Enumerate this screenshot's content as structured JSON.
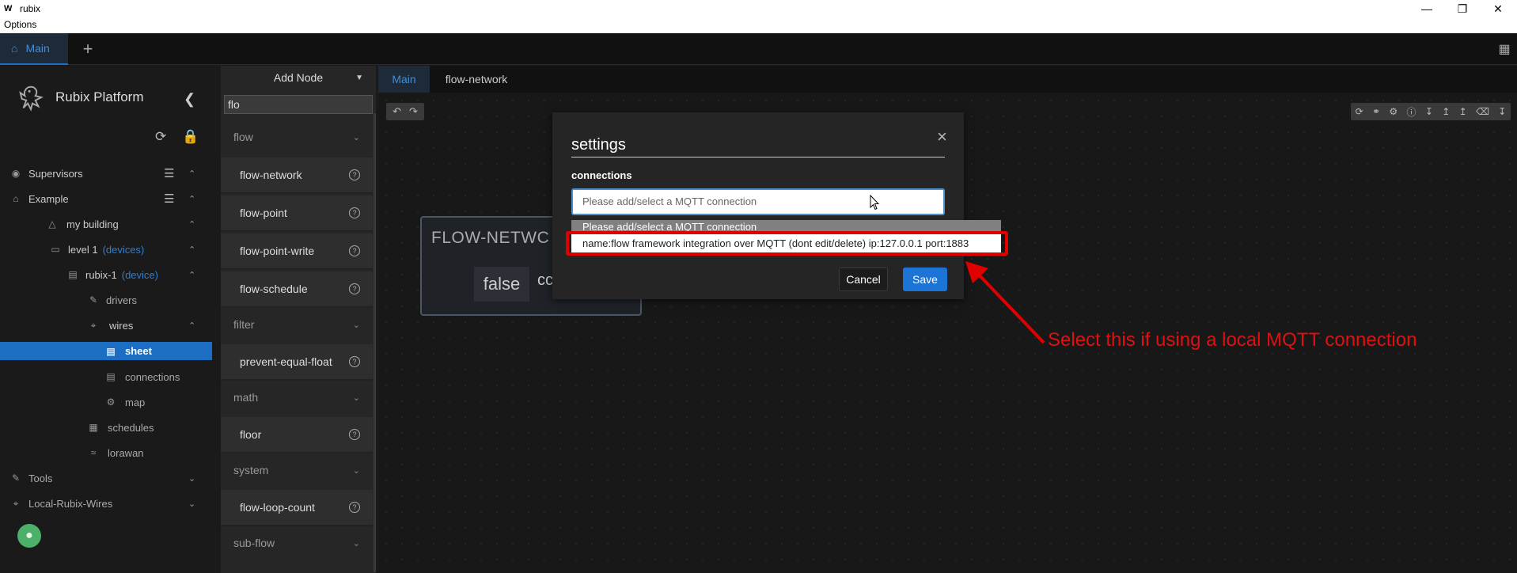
{
  "window": {
    "logo_text": "W",
    "title": "rubix",
    "menu": "Options",
    "minimize_icon": "minimize-icon",
    "restore_icon": "restore-icon",
    "close_icon": "close-icon"
  },
  "app_tabs": {
    "main_label": "Main",
    "add_label": "+"
  },
  "sidebar": {
    "brand": "Rubix Platform",
    "items": [
      {
        "label": "Supervisors",
        "icon": "eye-icon"
      },
      {
        "label": "Example",
        "icon": "home-icon"
      },
      {
        "label": "my building",
        "icon": "warning-icon"
      },
      {
        "label": "level 1",
        "tag": "(devices)",
        "icon": "laptop-icon"
      },
      {
        "label": "rubix-1",
        "tag": "(device)",
        "icon": "server-icon"
      },
      {
        "label": "drivers",
        "icon": "wrench-icon"
      },
      {
        "label": "wires",
        "icon": "wires-icon"
      },
      {
        "label": "sheet",
        "icon": "sheet-icon"
      },
      {
        "label": "connections",
        "icon": "connections-icon"
      },
      {
        "label": "map",
        "icon": "map-icon"
      },
      {
        "label": "schedules",
        "icon": "calendar-icon"
      },
      {
        "label": "lorawan",
        "icon": "wifi-icon"
      },
      {
        "label": "Tools",
        "icon": "wrench-icon"
      },
      {
        "label": "Local-Rubix-Wires",
        "icon": "wires-icon"
      }
    ]
  },
  "node_panel": {
    "title": "Add Node",
    "search_value": "flo",
    "categories": [
      {
        "label": "flow"
      },
      {
        "label": "filter"
      },
      {
        "label": "math"
      },
      {
        "label": "system"
      },
      {
        "label": "sub-flow"
      }
    ],
    "nodes": [
      {
        "label": "flow-network"
      },
      {
        "label": "flow-point"
      },
      {
        "label": "flow-point-write"
      },
      {
        "label": "flow-schedule"
      },
      {
        "label": "prevent-equal-float"
      },
      {
        "label": "floor"
      },
      {
        "label": "flow-loop-count"
      }
    ],
    "help_glyph": "?"
  },
  "editor": {
    "tabs": [
      "Main",
      "flow-network"
    ]
  },
  "canvas_node": {
    "header": "FLOW-NETWC",
    "value": "false",
    "value2": "cc"
  },
  "modal": {
    "title": "settings",
    "close": "×",
    "section_label": "connections",
    "select_placeholder": "Please add/select a MQTT connection",
    "cancel": "Cancel",
    "save": "Save"
  },
  "dropdown": {
    "options": [
      "Please add/select a MQTT connection",
      "name:flow framework integration over MQTT (dont edit/delete) ip:127.0.0.1 port:1883"
    ]
  },
  "annotation": {
    "text": "Select this if using a local MQTT connection",
    "color": "#e10000"
  },
  "colors": {
    "accent": "#1b6ec2",
    "save_button": "#1b74d6",
    "tag_blue": "#2f7fd0"
  }
}
